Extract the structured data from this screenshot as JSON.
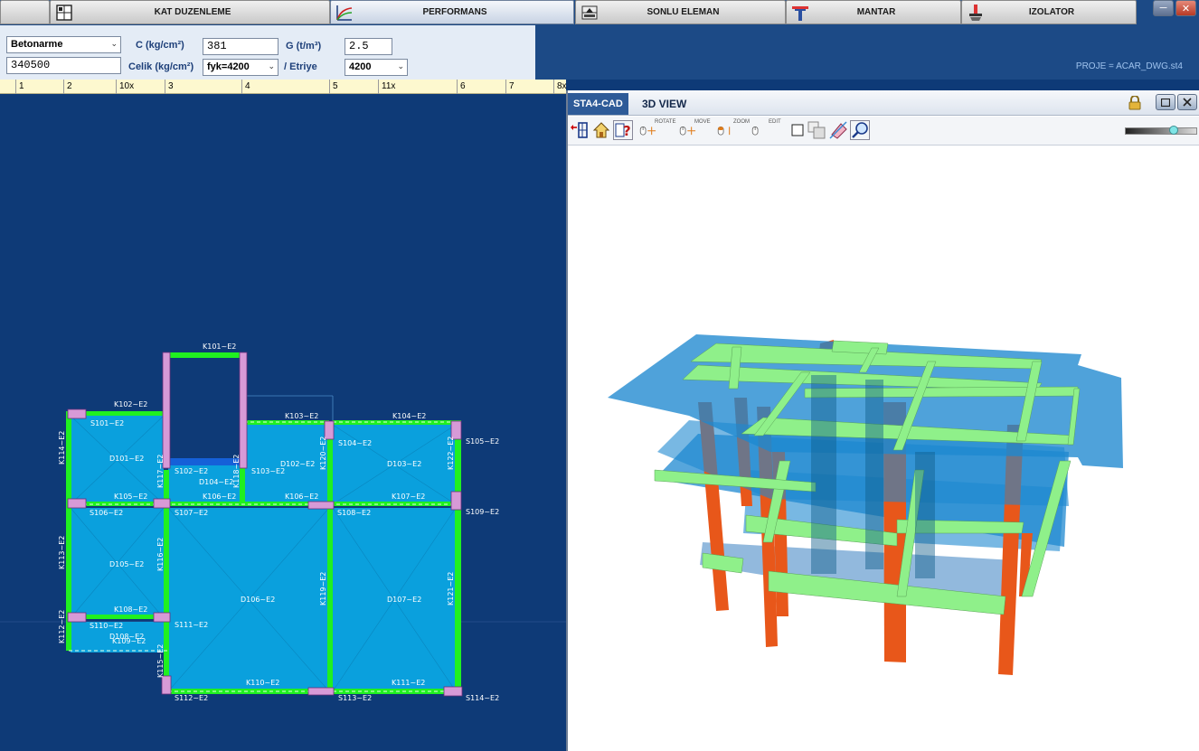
{
  "tabs": [
    {
      "label": "KAT DUZENLEME",
      "icon": "floor-plan-icon",
      "active": false
    },
    {
      "label": "PERFORMANS",
      "icon": "performance-curve-icon",
      "active": true
    },
    {
      "label": "SONLU ELEMAN",
      "icon": "finite-element-icon",
      "active": false
    },
    {
      "label": "MANTAR",
      "icon": "mushroom-slab-icon",
      "active": false
    },
    {
      "label": "IZOLATOR",
      "icon": "isolator-icon",
      "active": false
    }
  ],
  "window_controls": {
    "minimize": "─",
    "close": "✕"
  },
  "props": {
    "material_select": "Betonarme",
    "code_value": "340500",
    "c_label": "C (kg/cm²)",
    "c_value": "381",
    "g_label": "G (t/m³)",
    "g_value": "2.5",
    "celik_label": "Celik  (kg/cm²)",
    "celik_select": "fyk=4200",
    "etriye_label": "/ Etriye",
    "etriye_select": "4200"
  },
  "project_label": "PROJE = ACAR_DWG.st4",
  "ruler": {
    "ticks": [
      "1",
      "2",
      "10x",
      "3",
      "4",
      "5",
      "11x",
      "6",
      "7",
      "8x"
    ]
  },
  "plan": {
    "beams": [
      "K101~E2",
      "K102~E2",
      "K103~E2",
      "K104~E2",
      "K105~E2",
      "K106~E2",
      "K106~E2",
      "K107~E2",
      "K108~E2",
      "K109~E2",
      "K110~E2",
      "K111~E2",
      "K112~E2",
      "K113~E2",
      "K114~E2",
      "K115~E2",
      "K116~E2",
      "K117~E2",
      "K118~E2",
      "K119~E2",
      "K120~E2",
      "K121~E2",
      "K122~E2"
    ],
    "columns": [
      "S101~E2",
      "S102~E2",
      "S103~E2",
      "S104~E2",
      "S105~E2",
      "S106~E2",
      "S107~E2",
      "S108~E2",
      "S109~E2",
      "S110~E2",
      "S111~E2",
      "S112~E2",
      "S113~E2",
      "S114~E2"
    ],
    "slabs": [
      "D101~E2",
      "D102~E2",
      "D103~E2",
      "D104~E2",
      "D105~E2",
      "D106~E2",
      "D107~E2",
      "D108~E2"
    ]
  },
  "view3d": {
    "tag": "STA4-CAD",
    "title": "3D VIEW",
    "tools": [
      "back-arrow-icon",
      "home-icon",
      "help-icon",
      "rotate-mouse-icon",
      "move-mouse-icon",
      "zoom-mouse-icon",
      "edit-mouse-icon",
      "checkbox-icon",
      "copy-window-icon",
      "eraser-icon",
      "magnify-icon"
    ],
    "tool_captions": [
      "ROTATE",
      "MOVE",
      "ZOOM",
      "EDIT"
    ],
    "colors": {
      "beam": "#8ff08a",
      "slab": "#1e88d0",
      "column": "#e8571a",
      "plan_slab": "#0aa0dd",
      "plan_beam": "#20f020",
      "plan_column": "#d79ad7"
    }
  }
}
